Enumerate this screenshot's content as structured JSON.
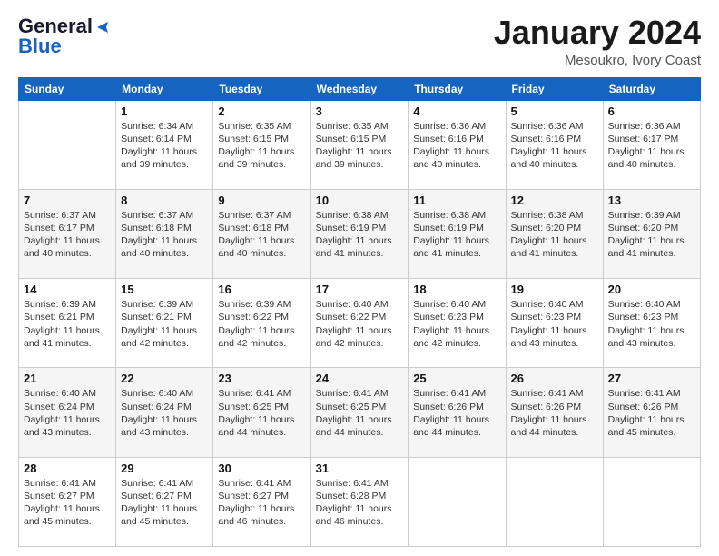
{
  "logo": {
    "line1": "General",
    "line2": "Blue"
  },
  "header": {
    "month": "January 2024",
    "location": "Mesoukro, Ivory Coast"
  },
  "days_of_week": [
    "Sunday",
    "Monday",
    "Tuesday",
    "Wednesday",
    "Thursday",
    "Friday",
    "Saturday"
  ],
  "weeks": [
    [
      {
        "day": "",
        "info": ""
      },
      {
        "day": "1",
        "info": "Sunrise: 6:34 AM\nSunset: 6:14 PM\nDaylight: 11 hours\nand 39 minutes."
      },
      {
        "day": "2",
        "info": "Sunrise: 6:35 AM\nSunset: 6:15 PM\nDaylight: 11 hours\nand 39 minutes."
      },
      {
        "day": "3",
        "info": "Sunrise: 6:35 AM\nSunset: 6:15 PM\nDaylight: 11 hours\nand 39 minutes."
      },
      {
        "day": "4",
        "info": "Sunrise: 6:36 AM\nSunset: 6:16 PM\nDaylight: 11 hours\nand 40 minutes."
      },
      {
        "day": "5",
        "info": "Sunrise: 6:36 AM\nSunset: 6:16 PM\nDaylight: 11 hours\nand 40 minutes."
      },
      {
        "day": "6",
        "info": "Sunrise: 6:36 AM\nSunset: 6:17 PM\nDaylight: 11 hours\nand 40 minutes."
      }
    ],
    [
      {
        "day": "7",
        "info": "Sunrise: 6:37 AM\nSunset: 6:17 PM\nDaylight: 11 hours\nand 40 minutes."
      },
      {
        "day": "8",
        "info": "Sunrise: 6:37 AM\nSunset: 6:18 PM\nDaylight: 11 hours\nand 40 minutes."
      },
      {
        "day": "9",
        "info": "Sunrise: 6:37 AM\nSunset: 6:18 PM\nDaylight: 11 hours\nand 40 minutes."
      },
      {
        "day": "10",
        "info": "Sunrise: 6:38 AM\nSunset: 6:19 PM\nDaylight: 11 hours\nand 41 minutes."
      },
      {
        "day": "11",
        "info": "Sunrise: 6:38 AM\nSunset: 6:19 PM\nDaylight: 11 hours\nand 41 minutes."
      },
      {
        "day": "12",
        "info": "Sunrise: 6:38 AM\nSunset: 6:20 PM\nDaylight: 11 hours\nand 41 minutes."
      },
      {
        "day": "13",
        "info": "Sunrise: 6:39 AM\nSunset: 6:20 PM\nDaylight: 11 hours\nand 41 minutes."
      }
    ],
    [
      {
        "day": "14",
        "info": "Sunrise: 6:39 AM\nSunset: 6:21 PM\nDaylight: 11 hours\nand 41 minutes."
      },
      {
        "day": "15",
        "info": "Sunrise: 6:39 AM\nSunset: 6:21 PM\nDaylight: 11 hours\nand 42 minutes."
      },
      {
        "day": "16",
        "info": "Sunrise: 6:39 AM\nSunset: 6:22 PM\nDaylight: 11 hours\nand 42 minutes."
      },
      {
        "day": "17",
        "info": "Sunrise: 6:40 AM\nSunset: 6:22 PM\nDaylight: 11 hours\nand 42 minutes."
      },
      {
        "day": "18",
        "info": "Sunrise: 6:40 AM\nSunset: 6:23 PM\nDaylight: 11 hours\nand 42 minutes."
      },
      {
        "day": "19",
        "info": "Sunrise: 6:40 AM\nSunset: 6:23 PM\nDaylight: 11 hours\nand 43 minutes."
      },
      {
        "day": "20",
        "info": "Sunrise: 6:40 AM\nSunset: 6:23 PM\nDaylight: 11 hours\nand 43 minutes."
      }
    ],
    [
      {
        "day": "21",
        "info": "Sunrise: 6:40 AM\nSunset: 6:24 PM\nDaylight: 11 hours\nand 43 minutes."
      },
      {
        "day": "22",
        "info": "Sunrise: 6:40 AM\nSunset: 6:24 PM\nDaylight: 11 hours\nand 43 minutes."
      },
      {
        "day": "23",
        "info": "Sunrise: 6:41 AM\nSunset: 6:25 PM\nDaylight: 11 hours\nand 44 minutes."
      },
      {
        "day": "24",
        "info": "Sunrise: 6:41 AM\nSunset: 6:25 PM\nDaylight: 11 hours\nand 44 minutes."
      },
      {
        "day": "25",
        "info": "Sunrise: 6:41 AM\nSunset: 6:26 PM\nDaylight: 11 hours\nand 44 minutes."
      },
      {
        "day": "26",
        "info": "Sunrise: 6:41 AM\nSunset: 6:26 PM\nDaylight: 11 hours\nand 44 minutes."
      },
      {
        "day": "27",
        "info": "Sunrise: 6:41 AM\nSunset: 6:26 PM\nDaylight: 11 hours\nand 45 minutes."
      }
    ],
    [
      {
        "day": "28",
        "info": "Sunrise: 6:41 AM\nSunset: 6:27 PM\nDaylight: 11 hours\nand 45 minutes."
      },
      {
        "day": "29",
        "info": "Sunrise: 6:41 AM\nSunset: 6:27 PM\nDaylight: 11 hours\nand 45 minutes."
      },
      {
        "day": "30",
        "info": "Sunrise: 6:41 AM\nSunset: 6:27 PM\nDaylight: 11 hours\nand 46 minutes."
      },
      {
        "day": "31",
        "info": "Sunrise: 6:41 AM\nSunset: 6:28 PM\nDaylight: 11 hours\nand 46 minutes."
      },
      {
        "day": "",
        "info": ""
      },
      {
        "day": "",
        "info": ""
      },
      {
        "day": "",
        "info": ""
      }
    ]
  ]
}
